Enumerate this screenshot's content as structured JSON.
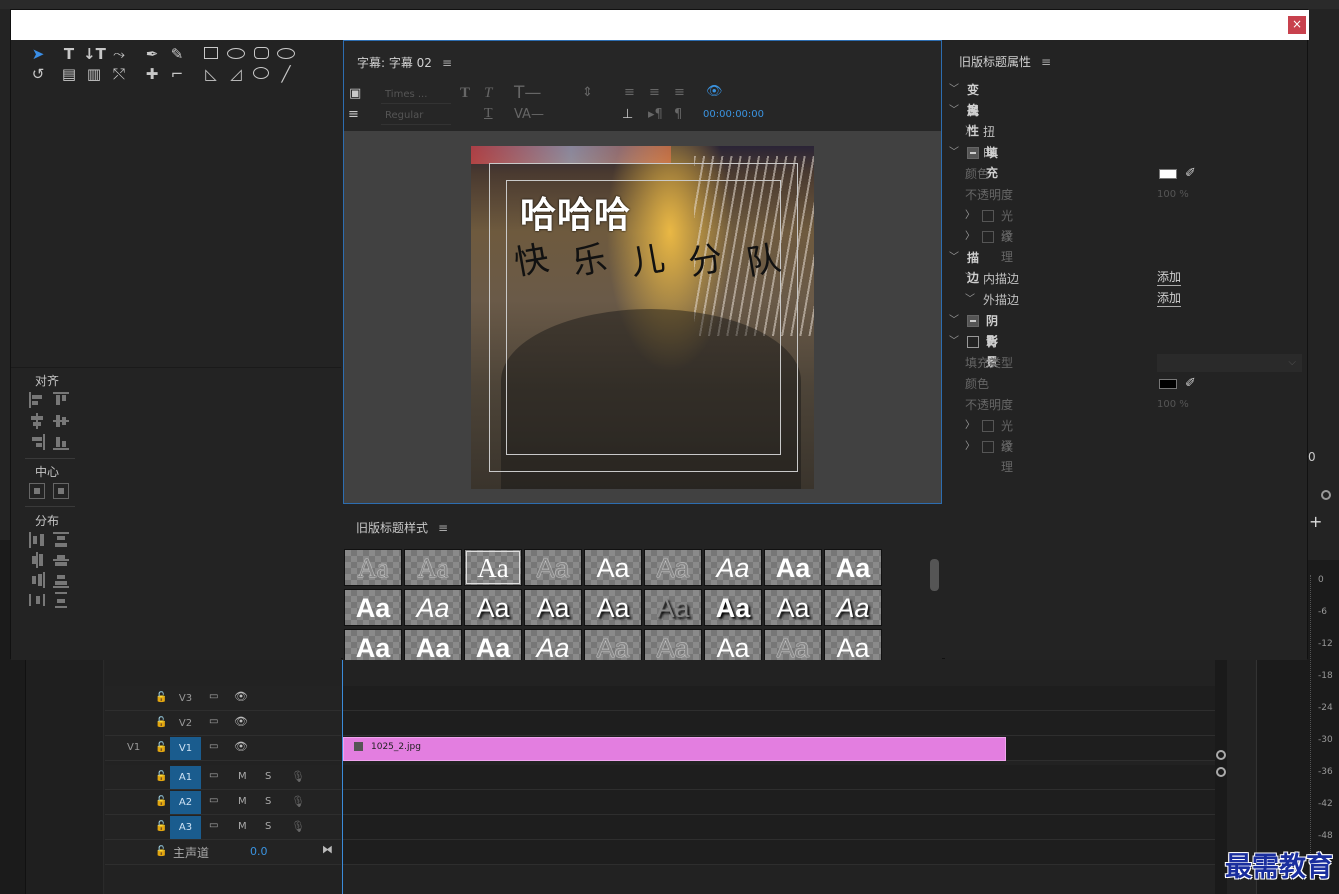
{
  "dialog": {
    "close_label": "×"
  },
  "designer": {
    "title": "字幕: 字幕 02",
    "font_family": "Times ...",
    "font_style": "Regular",
    "timecode": "00:00:00:00",
    "title_main": "哈哈哈",
    "title_sub": [
      "快",
      "乐",
      "儿",
      "分",
      "队"
    ]
  },
  "align": {
    "align_label": "对齐",
    "center_label": "中心",
    "distribute_label": "分布"
  },
  "styles": {
    "title": "旧版标题样式",
    "swatch_text": "Aa"
  },
  "props": {
    "title": "旧版标题属性",
    "rows": {
      "transform": "变换",
      "attributes": "属性",
      "distort": "扭曲",
      "fill": "填充",
      "fill_color": "颜色",
      "fill_opacity": "不透明度",
      "fill_opacity_val": "100 %",
      "fill_sheen": "光泽",
      "fill_texture": "纹理",
      "stroke": "描边",
      "inner_stroke": "内描边",
      "outer_stroke": "外描边",
      "add1": "添加",
      "add2": "添加",
      "shadow": "阴影",
      "background": "背景",
      "fill_type": "填充类型",
      "bg_color": "颜色",
      "bg_opacity": "不透明度",
      "bg_opacity_val": "100 %",
      "bg_sheen": "光泽",
      "bg_texture": "纹理"
    },
    "colors": {
      "fill": "#ffffff",
      "background": "#000000"
    }
  },
  "timeline": {
    "tracks": [
      {
        "id": "V3"
      },
      {
        "id": "V2"
      },
      {
        "id": "V1",
        "source": "V1"
      }
    ],
    "audio": [
      {
        "id": "A1"
      },
      {
        "id": "A2"
      },
      {
        "id": "A3"
      }
    ],
    "m_label": "M",
    "s_label": "S",
    "master_label": "主声道",
    "master_value": "0.0",
    "clip_name": "1025_2.jpg"
  },
  "bg": {
    "meter_ticks": [
      "0",
      "-6",
      "-12",
      "-18",
      "-24",
      "-30",
      "-36",
      "-42",
      "-48"
    ],
    "zero": "0"
  },
  "watermark": "最需教育"
}
